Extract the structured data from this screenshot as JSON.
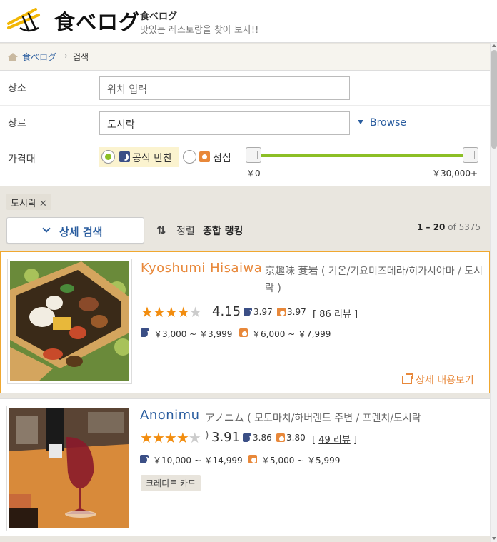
{
  "header": {
    "logo_text": "食べログ",
    "brand": "食べログ",
    "tagline": "맛있는 레스토랑을 찾아 보자!!"
  },
  "breadcrumb": {
    "home": "食べログ",
    "separator": "›",
    "current": "검색"
  },
  "search": {
    "location_label": "장소",
    "location_placeholder": "위치 입력",
    "genre_label": "장르",
    "genre_value": "도시락",
    "browse_label": "Browse",
    "price_label": "가격대",
    "price_options": [
      {
        "label": "공식 만찬",
        "icon": "moon-icon",
        "selected": true
      },
      {
        "label": "점심",
        "icon": "sun-icon",
        "selected": false
      }
    ],
    "price_min": "￥0",
    "price_max": "￥30,000+",
    "price_range_fraction": [
      0,
      1
    ]
  },
  "filters": {
    "active_tag": "도시락",
    "tag_remove": "✕",
    "detail_search": "상세 검색",
    "sort_icon": "⇅",
    "sort_label": "정렬",
    "sort_value": "종합 랭킹",
    "count_range": "1 – 20",
    "count_of": "of",
    "count_total": "5375"
  },
  "results": [
    {
      "name": "Kyoshumi Hisaiwa",
      "meta": "京趣味 菱岩 ( 기온/기요미즈데라/히가시야마 / 도시락 )",
      "rating": "4.15",
      "rating_value": 4.15,
      "dinner_score": "3.97",
      "lunch_score": "3.97",
      "reviews_open": "[",
      "reviews": "86 리뷰",
      "reviews_close": "]",
      "dinner_price": "￥3,000 ~ ￥3,999",
      "lunch_price": "￥6,000 ~ ￥7,999",
      "detail_link": "상세 내용보기"
    },
    {
      "name": "Anonimu",
      "meta": "アノニム ( 모토마치/하버랜드 주변 / 프렌치/도시락 )",
      "rating": "3.91",
      "rating_value": 3.91,
      "dinner_score": "3.86",
      "lunch_score": "3.80",
      "reviews_open": "[",
      "reviews": "49 리뷰",
      "reviews_close": "]",
      "dinner_price": "￥10,000 ~ ￥14,999",
      "lunch_price": "￥5,000 ~ ￥5,999",
      "badge": "크레디트 카드"
    }
  ],
  "colors": {
    "accent_orange": "#e8883a",
    "link_blue": "#2a5d9f",
    "slider_green": "#8cbf26",
    "star": "#f28d0f"
  }
}
